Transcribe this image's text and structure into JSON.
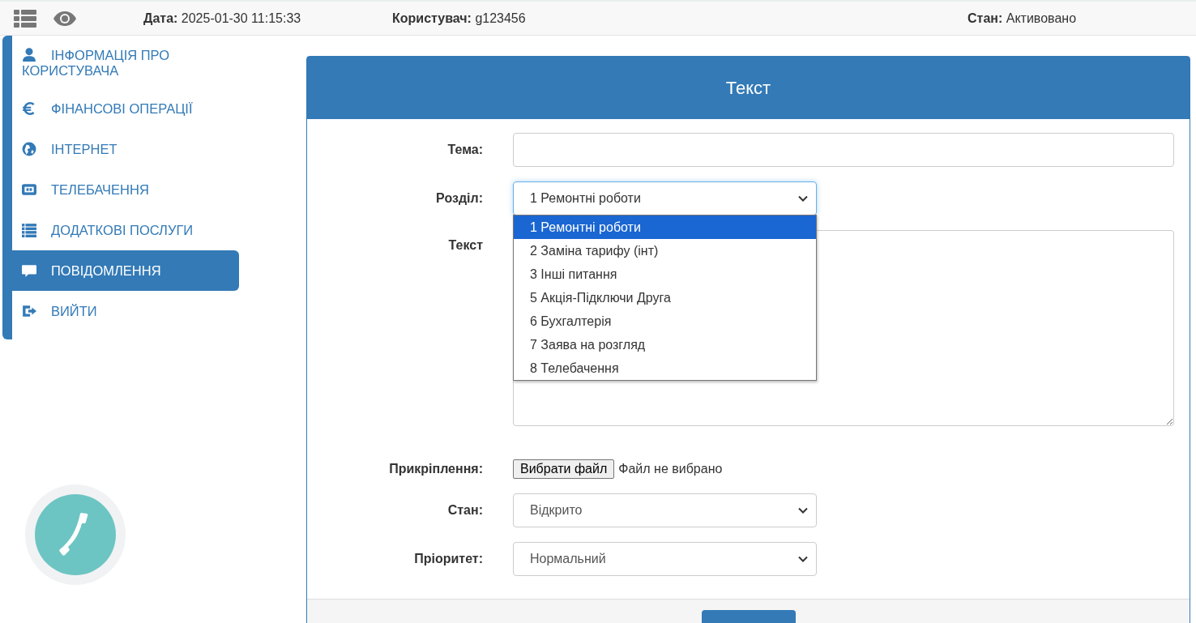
{
  "top_bar": {
    "items": [
      {
        "label": "Дата:",
        "value": "2025-01-30 11:15:33"
      },
      {
        "label": "Користувач:",
        "value": "g123456"
      },
      {
        "label": "Стан:",
        "value": "Активовано"
      }
    ]
  },
  "sidebar": {
    "items": [
      {
        "kind": "user",
        "label": "ІНФОРМАЦІЯ ПРО КОРИСТУВАЧА",
        "selected": false
      },
      {
        "kind": "euro",
        "label": "ФІНАНСОВІ ОПЕРАЦІЇ",
        "selected": false
      },
      {
        "kind": "globe",
        "label": "ІНТЕРНЕТ",
        "selected": false
      },
      {
        "kind": "tv",
        "label": "ТЕЛЕБАЧЕННЯ",
        "selected": false
      },
      {
        "kind": "list",
        "label": "ДОДАТКОВІ ПОСЛУГИ",
        "selected": false
      },
      {
        "kind": "chat",
        "label": "ПОВІДОМЛЕННЯ",
        "selected": true
      },
      {
        "kind": "exit",
        "label": "ВИЙТИ",
        "selected": false
      }
    ]
  },
  "form": {
    "title": "Текст",
    "fields": [
      {
        "kind": "text",
        "label": "Тема:"
      },
      {
        "kind": "select",
        "label": "Розділ:",
        "value": "1 Ремонтні роботи",
        "open": true,
        "options": [
          {
            "label": "1 Ремонтні роботи",
            "selected": true
          },
          {
            "label": "2 Заміна тарифу (інт)",
            "selected": false
          },
          {
            "label": "3 Інші питання",
            "selected": false
          },
          {
            "label": "5 Акція-Підключи Друга",
            "selected": false
          },
          {
            "label": "6 Бухгалтерія",
            "selected": false
          },
          {
            "label": "7 Заява на розгляд",
            "selected": false
          },
          {
            "label": "8 Телебачення",
            "selected": false
          }
        ]
      },
      {
        "kind": "textarea",
        "label": "Текст"
      },
      {
        "kind": "file",
        "label": "Прикріплення:",
        "button": "Вибрати файл",
        "status": "Файл не вибрано"
      },
      {
        "kind": "select",
        "label": "Стан:",
        "value": "Відкрито",
        "open": false
      },
      {
        "kind": "select",
        "label": "Пріоритет:",
        "value": "Нормальний",
        "open": false
      }
    ]
  }
}
